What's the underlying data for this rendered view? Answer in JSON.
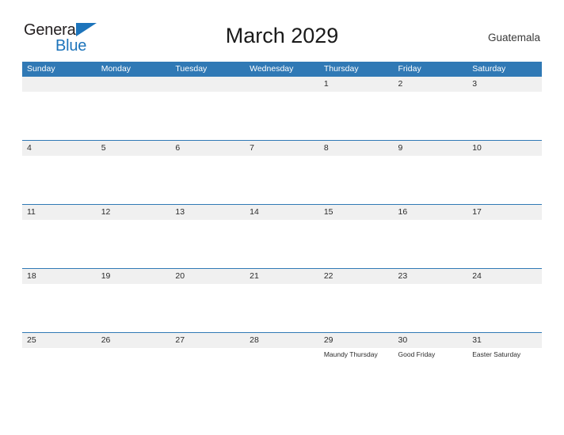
{
  "branding": {
    "logo_text_primary": "General",
    "logo_text_secondary": "Blue",
    "logo_color_dark": "#231f20",
    "logo_color_blue": "#1d74bb"
  },
  "header": {
    "title": "March 2029",
    "country": "Guatemala"
  },
  "theme": {
    "header_blue": "#3079b5",
    "row_line_blue": "#3079b5",
    "date_band_gray": "#f0f0f0",
    "page_background": "#ffffff",
    "text_dark": "#2b2b2b"
  },
  "calendar": {
    "month": "March",
    "year": "2029",
    "weekday_headers": [
      "Sunday",
      "Monday",
      "Tuesday",
      "Wednesday",
      "Thursday",
      "Friday",
      "Saturday"
    ],
    "weeks": [
      [
        {
          "date": "",
          "events": []
        },
        {
          "date": "",
          "events": []
        },
        {
          "date": "",
          "events": []
        },
        {
          "date": "",
          "events": []
        },
        {
          "date": "1",
          "events": []
        },
        {
          "date": "2",
          "events": []
        },
        {
          "date": "3",
          "events": []
        }
      ],
      [
        {
          "date": "4",
          "events": []
        },
        {
          "date": "5",
          "events": []
        },
        {
          "date": "6",
          "events": []
        },
        {
          "date": "7",
          "events": []
        },
        {
          "date": "8",
          "events": []
        },
        {
          "date": "9",
          "events": []
        },
        {
          "date": "10",
          "events": []
        }
      ],
      [
        {
          "date": "11",
          "events": []
        },
        {
          "date": "12",
          "events": []
        },
        {
          "date": "13",
          "events": []
        },
        {
          "date": "14",
          "events": []
        },
        {
          "date": "15",
          "events": []
        },
        {
          "date": "16",
          "events": []
        },
        {
          "date": "17",
          "events": []
        }
      ],
      [
        {
          "date": "18",
          "events": []
        },
        {
          "date": "19",
          "events": []
        },
        {
          "date": "20",
          "events": []
        },
        {
          "date": "21",
          "events": []
        },
        {
          "date": "22",
          "events": []
        },
        {
          "date": "23",
          "events": []
        },
        {
          "date": "24",
          "events": []
        }
      ],
      [
        {
          "date": "25",
          "events": []
        },
        {
          "date": "26",
          "events": []
        },
        {
          "date": "27",
          "events": []
        },
        {
          "date": "28",
          "events": []
        },
        {
          "date": "29",
          "events": [
            "Maundy Thursday"
          ]
        },
        {
          "date": "30",
          "events": [
            "Good Friday"
          ]
        },
        {
          "date": "31",
          "events": [
            "Easter Saturday"
          ]
        }
      ]
    ]
  }
}
